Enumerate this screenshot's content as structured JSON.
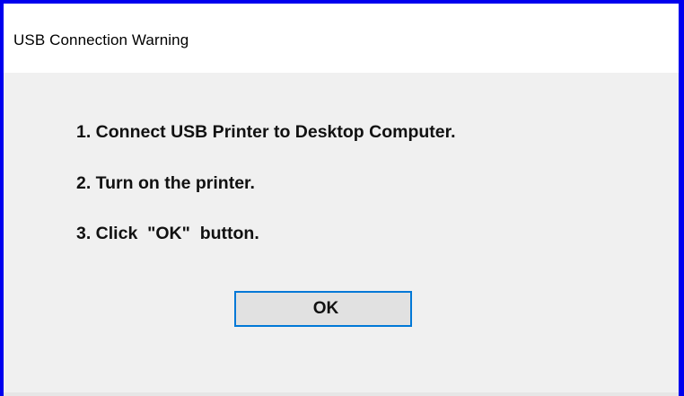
{
  "window": {
    "title": "USB Connection Warning",
    "frame_color": "#0000ee"
  },
  "instructions": [
    "1. Connect USB Printer to Desktop Computer.",
    "2. Turn on the printer.",
    "3. Click  \"OK\"  button."
  ],
  "buttons": {
    "ok_label": "OK",
    "focus_border_color": "#0078d7"
  }
}
